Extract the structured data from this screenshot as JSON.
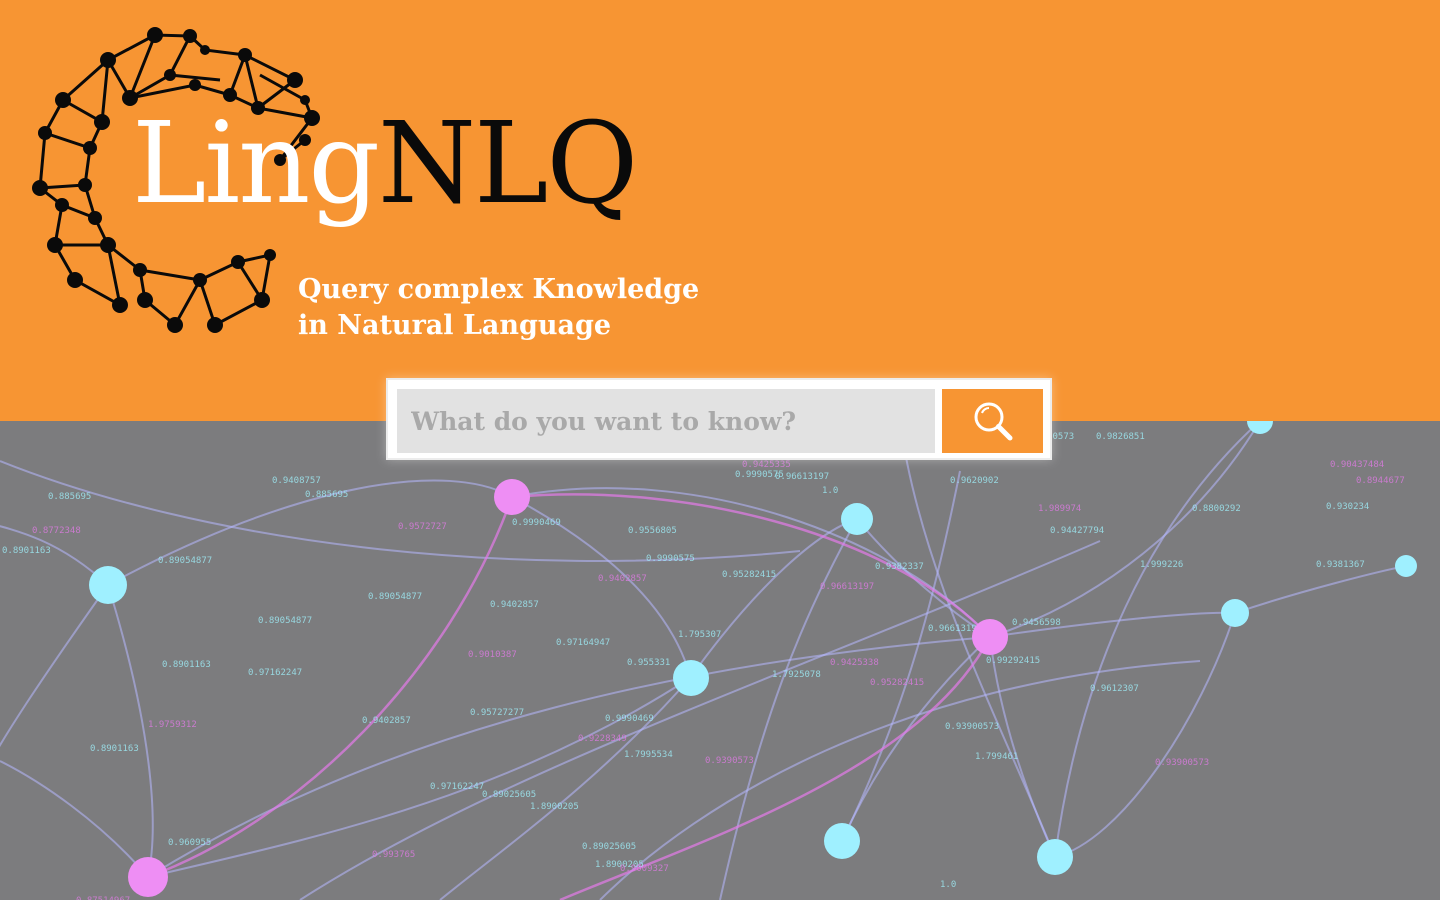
{
  "brand": {
    "title_part1": "Ling",
    "title_part2": "NLQ",
    "tagline_line1": "Query complex Knowledge",
    "tagline_line2": "in Natural Language"
  },
  "search": {
    "placeholder": "What do you want to know?",
    "value": "",
    "button_icon": "search-icon"
  },
  "colors": {
    "header_background": "#f79533",
    "page_background": "#7c7c7e",
    "search_button": "#f79533",
    "node_cyan": "#9ff0ff",
    "node_pink": "#ee8ef4"
  },
  "network_labels": [
    "0.885695",
    "0.9408757",
    "0.885695",
    "0.8772348",
    "0.8901163",
    "0.89054877",
    "0.9572727",
    "0.9990469",
    "0.9425335",
    "0.9990575",
    "0.96613197",
    "1.0",
    "0.9620902",
    "1.989974",
    "0.94427794",
    "0.8800292",
    "0.930234",
    "0.90437484",
    "0.8944677",
    "0.9381367",
    "1.999226",
    "0.89054877",
    "0.89054877",
    "0.9402857",
    "0.9402857",
    "0.9556805",
    "0.9990575",
    "0.95282415",
    "0.96613197",
    "0.9382337",
    "0.9456598",
    "0.96613197",
    "0.97164947",
    "0.9010387",
    "0.8901163",
    "0.97162247",
    "1.795307",
    "0.955331",
    "0.9425338",
    "0.95282415",
    "0.99292415",
    "0.9612307",
    "1.7925078",
    "1.9759312",
    "0.9402857",
    "0.8901163",
    "0.9990469",
    "0.95727277",
    "0.9228349",
    "1.7995534",
    "0.9390573",
    "0.93900573",
    "1.799461",
    "0.93900573",
    "0.97162247",
    "0.89025605",
    "1.8900205",
    "0.960955",
    "0.993765",
    "0.89025605",
    "1.8900205",
    "0.9009327",
    "1.0",
    "0.87514967",
    "0.9826851",
    "0.89900573"
  ]
}
